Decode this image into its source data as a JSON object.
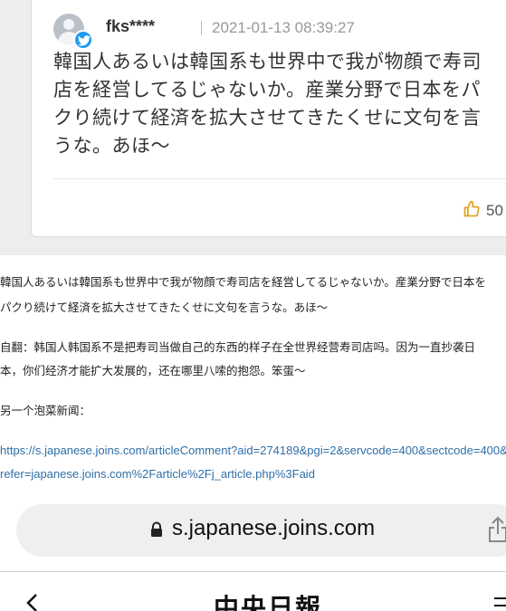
{
  "comment": {
    "username": "fks****",
    "timestamp": "2021-01-13 08:39:27",
    "lines": [
      "韓国人あるいは韓国系も世界中で我が物顔で寿司",
      "店を経営してるじゃないか。産業分野で日本をパ",
      "クり続けて経済を拡大させてきたくせに文句を言",
      "うな。あほ〜"
    ],
    "like_count": "50"
  },
  "article": {
    "original_lines": [
      "韓国人あるいは韓国系も世界中で我が物顔で寿司店を経営してるじゃないか。産業分野で日本を",
      "パクり続けて経済を拡大させてきたくせに文句を言うな。あほ～"
    ],
    "translation_lines": [
      "自翻：韩国人韩国系不是把寿司当做自己的东西的样子在全世界经营寿司店吗。因为一直抄袭日",
      "本，你们经济才能扩大发展的，还在哪里八嗦的抱怨。笨蛋～"
    ],
    "another_news": "另一个泡菜新闻：",
    "link_lines": [
      "https://s.japanese.joins.com/articleComment?aid=274189&pgi=2&servcode=400&sectcode=400&",
      "refer=japanese.joins.com%2Farticle%2Fj_article.php%3Faid"
    ]
  },
  "browser": {
    "url": "s.japanese.joins.com",
    "site_title": "中央日報"
  },
  "icons": {
    "avatar": "default-avatar-icon",
    "badge": "twitter-icon",
    "like": "thumbs-up-icon",
    "lock": "lock-icon",
    "share": "share-icon",
    "back": "chevron-left-icon",
    "menu": "hamburger-menu-icon"
  },
  "colors": {
    "twitter_blue": "#1d9bf0",
    "like_icon": "#e0a020",
    "link": "#2f6fa7"
  }
}
